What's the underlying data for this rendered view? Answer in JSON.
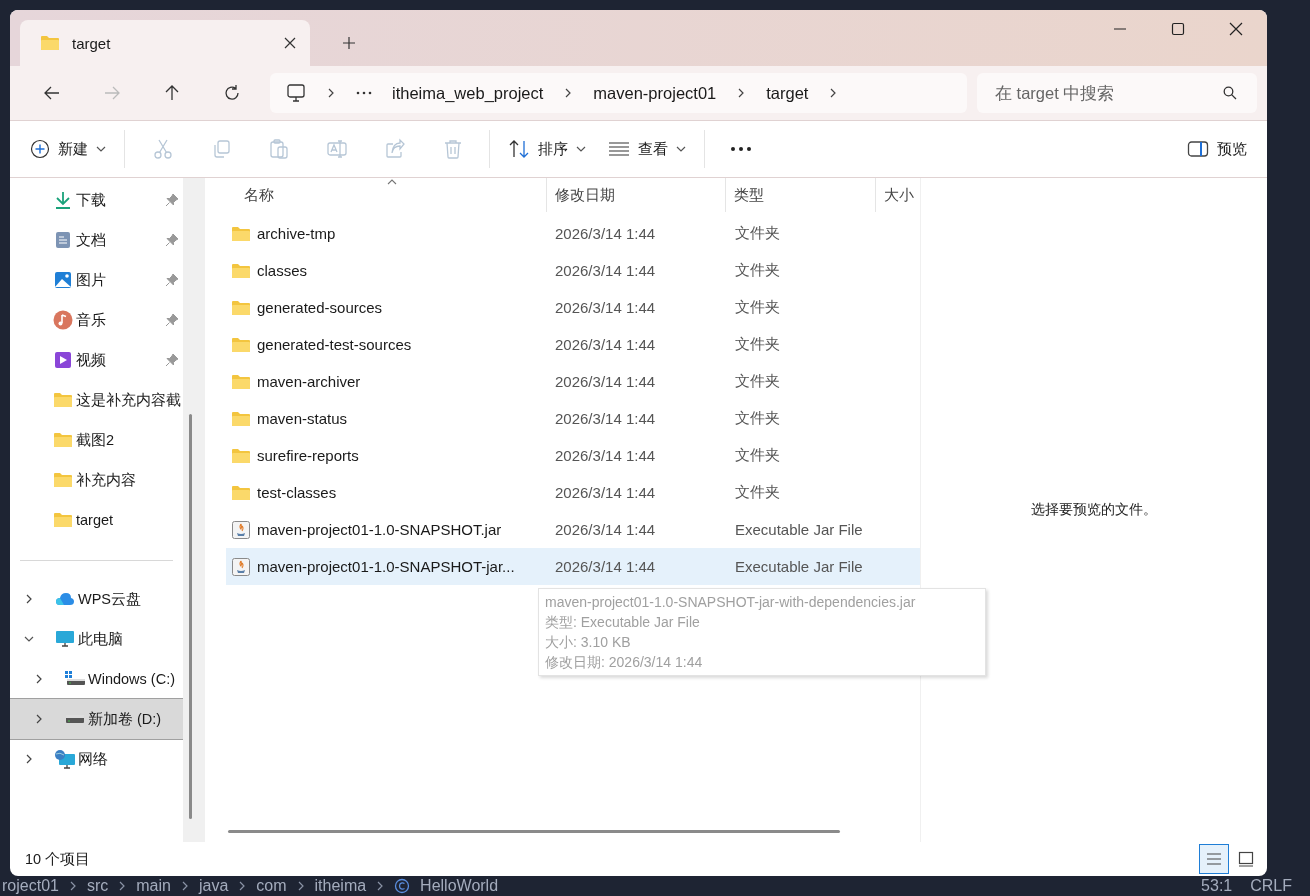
{
  "window": {
    "tabs": [
      {
        "label": "target",
        "selected": true
      }
    ]
  },
  "nav": [
    {
      "kind": "back",
      "disabled": false
    },
    {
      "kind": "forward",
      "disabled": true
    },
    {
      "kind": "up",
      "disabled": false
    },
    {
      "kind": "refresh",
      "disabled": false
    }
  ],
  "address": {
    "path": [
      "itheima_web_project",
      "maven-project01",
      "target"
    ]
  },
  "search": {
    "placeholder": "在 target 中搜索"
  },
  "toolbar": {
    "new": "新建",
    "actions": [
      {
        "kind": "cut",
        "disabled": true
      },
      {
        "kind": "copy",
        "disabled": true
      },
      {
        "kind": "paste",
        "disabled": true
      },
      {
        "kind": "rename",
        "disabled": true
      },
      {
        "kind": "share",
        "disabled": true
      },
      {
        "kind": "delete",
        "disabled": true
      }
    ],
    "sort": "排序",
    "view": "查看",
    "preview": "预览"
  },
  "sidebar": {
    "quick_access": [
      {
        "label": "下载",
        "kind": "download",
        "pinned": true
      },
      {
        "label": "文档",
        "kind": "documents",
        "pinned": true
      },
      {
        "label": "图片",
        "kind": "pictures",
        "pinned": true
      },
      {
        "label": "音乐",
        "kind": "music",
        "pinned": true
      },
      {
        "label": "视频",
        "kind": "videos",
        "pinned": true
      },
      {
        "label": "这是补充内容截",
        "kind": "folder",
        "pinned": false
      },
      {
        "label": "截图2",
        "kind": "folder",
        "pinned": false
      },
      {
        "label": "补充内容",
        "kind": "folder",
        "pinned": false
      },
      {
        "label": "target",
        "kind": "folder",
        "pinned": false
      }
    ],
    "tree": [
      {
        "label": "WPS云盘",
        "kind": "cloud",
        "expanded": false,
        "selected": false
      },
      {
        "label": "此电脑",
        "kind": "computer",
        "expanded": true,
        "selected": false,
        "children": [
          {
            "label": "Windows (C:)",
            "kind": "system-drive",
            "expanded": false,
            "selected": false
          },
          {
            "label": "新加卷 (D:)",
            "kind": "drive",
            "expanded": false,
            "selected": true
          }
        ]
      },
      {
        "label": "网络",
        "kind": "network",
        "expanded": false,
        "selected": false
      }
    ]
  },
  "file_list": {
    "columns": [
      "名称",
      "修改日期",
      "类型",
      "大小"
    ],
    "rows": [
      {
        "name": "archive-tmp",
        "modified": "2026/3/14 1:44",
        "type": "文件夹",
        "kind": "folder",
        "selected": false
      },
      {
        "name": "classes",
        "modified": "2026/3/14 1:44",
        "type": "文件夹",
        "kind": "folder",
        "selected": false
      },
      {
        "name": "generated-sources",
        "modified": "2026/3/14 1:44",
        "type": "文件夹",
        "kind": "folder",
        "selected": false
      },
      {
        "name": "generated-test-sources",
        "modified": "2026/3/14 1:44",
        "type": "文件夹",
        "kind": "folder",
        "selected": false
      },
      {
        "name": "maven-archiver",
        "modified": "2026/3/14 1:44",
        "type": "文件夹",
        "kind": "folder",
        "selected": false
      },
      {
        "name": "maven-status",
        "modified": "2026/3/14 1:44",
        "type": "文件夹",
        "kind": "folder",
        "selected": false
      },
      {
        "name": "surefire-reports",
        "modified": "2026/3/14 1:44",
        "type": "文件夹",
        "kind": "folder",
        "selected": false
      },
      {
        "name": "test-classes",
        "modified": "2026/3/14 1:44",
        "type": "文件夹",
        "kind": "folder",
        "selected": false
      },
      {
        "name": "maven-project01-1.0-SNAPSHOT.jar",
        "modified": "2026/3/14 1:44",
        "type": "Executable Jar File",
        "kind": "jar",
        "selected": false
      },
      {
        "name": "maven-project01-1.0-SNAPSHOT-jar...",
        "modified": "2026/3/14 1:44",
        "type": "Executable Jar File",
        "kind": "jar",
        "selected": true
      }
    ]
  },
  "tooltip": {
    "lines": [
      "maven-project01-1.0-SNAPSHOT-jar-with-dependencies.jar",
      "类型: Executable Jar File",
      "大小: 3.10 KB",
      "修改日期: 2026/3/14 1:44"
    ]
  },
  "preview_pane": {
    "message": "选择要预览的文件。"
  },
  "status_bar": {
    "item_count": "10 个项目",
    "views": [
      {
        "kind": "details",
        "selected": true
      },
      {
        "kind": "tiles",
        "selected": false
      }
    ]
  },
  "ide": {
    "breadcrumb": [
      "roject01",
      "src",
      "main",
      "java",
      "com",
      "itheima",
      "HelloWorld"
    ],
    "position": "53:1",
    "line_ending": "CRLF"
  }
}
